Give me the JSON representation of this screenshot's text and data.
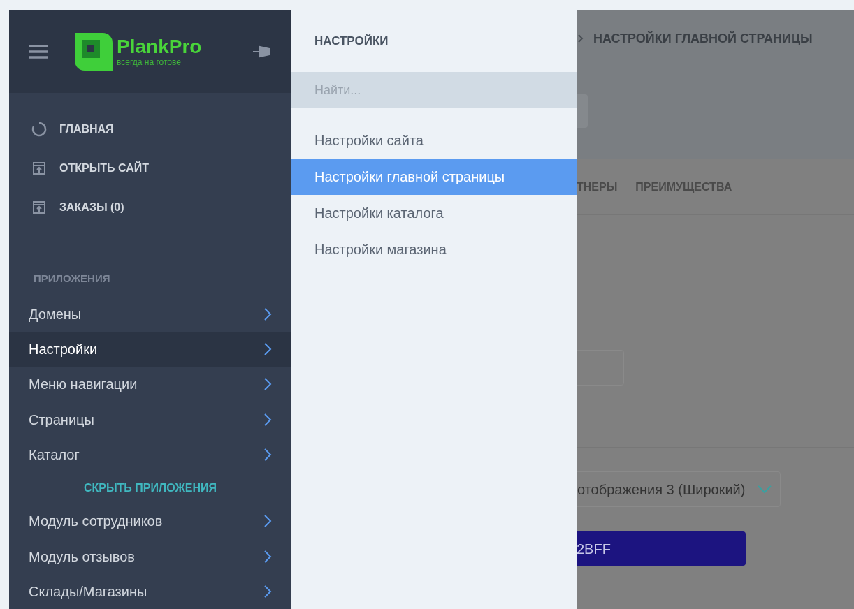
{
  "sidebar": {
    "logo": {
      "name": "PlankPro",
      "tagline": "всегда на готове"
    },
    "links": [
      {
        "kind": "home",
        "label": "ГЛАВНАЯ"
      },
      {
        "kind": "external",
        "label": "ОТКРЫТЬ САЙТ"
      },
      {
        "kind": "external",
        "label": "ЗАКАЗЫ (0)"
      }
    ],
    "section_title": "ПРИЛОЖЕНИЯ",
    "apps": [
      {
        "label": "Домены",
        "selected": false
      },
      {
        "label": "Настройки",
        "selected": true
      },
      {
        "label": "Меню навигации",
        "selected": false
      },
      {
        "label": "Страницы",
        "selected": false
      },
      {
        "label": "Каталог",
        "selected": false
      }
    ],
    "hide_apps": "СКРЫТЬ ПРИЛОЖЕНИЯ",
    "modules": [
      {
        "label": "Модуль сотрудников",
        "selected": false
      },
      {
        "label": "Модуль отзывов",
        "selected": false
      },
      {
        "label": "Склады/Магазины",
        "selected": false
      }
    ]
  },
  "flyout": {
    "title": "НАСТРОЙКИ",
    "search": {
      "placeholder": "Найти..."
    },
    "items": [
      {
        "label": "Настройки сайта",
        "selected": false
      },
      {
        "label": "Настройки главной страницы",
        "selected": true
      },
      {
        "label": "Настройки каталога",
        "selected": false
      },
      {
        "label": "Настройки магазина",
        "selected": false
      }
    ]
  },
  "content": {
    "breadcrumb": "НАСТРОЙКИ ГЛАВНОЙ СТРАНИЦЫ",
    "tabs": [
      "ТНЕРЫ",
      "ПРЕИМУЩЕСТВА"
    ],
    "select_value": "отображения 3 (Широкий)",
    "color_value": "2BFF"
  }
}
